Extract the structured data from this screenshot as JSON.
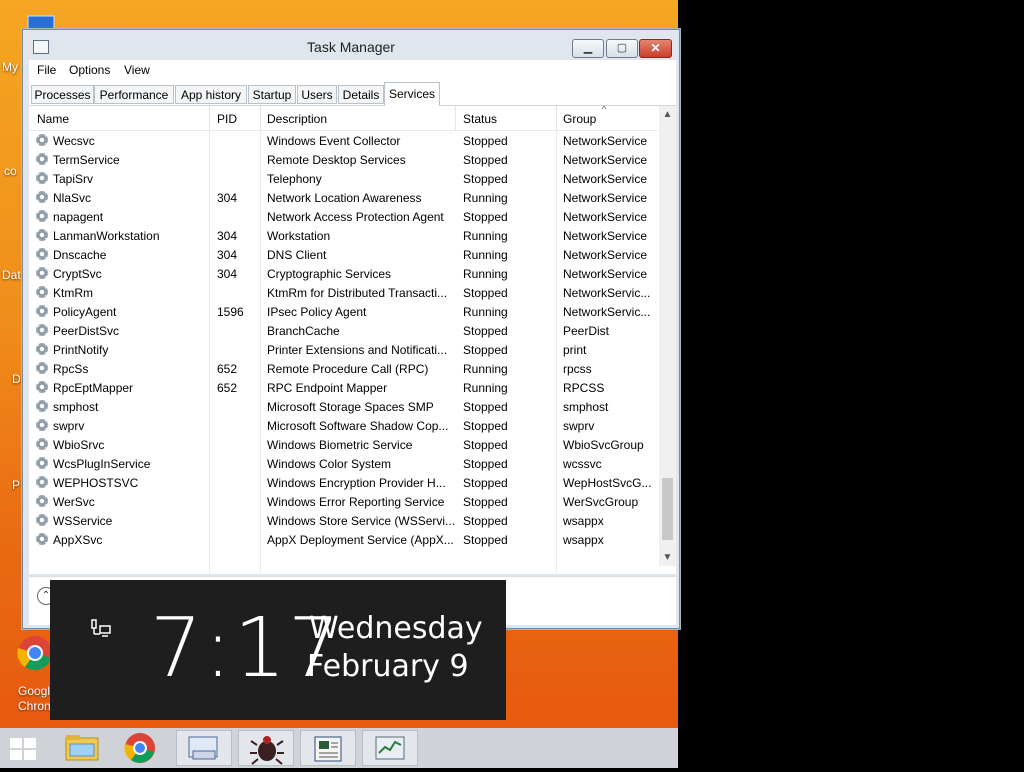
{
  "desktop": {
    "icons": [
      {
        "label": "My"
      },
      {
        "label": "co"
      },
      {
        "label": "Dat"
      },
      {
        "label": "D"
      },
      {
        "label": "P"
      },
      {
        "label": "Googl"
      },
      {
        "label": "Chron"
      }
    ]
  },
  "window": {
    "title": "Task Manager",
    "controls": {
      "minimize": "▁",
      "maximize": "▢",
      "close": "✕"
    }
  },
  "menu": [
    "File",
    "Options",
    "View"
  ],
  "tabs": [
    "Processes",
    "Performance",
    "App history",
    "Startup",
    "Users",
    "Details",
    "Services"
  ],
  "active_tab": "Services",
  "columns": [
    "Name",
    "PID",
    "Description",
    "Status",
    "Group"
  ],
  "sort_indicator": "^",
  "services": [
    {
      "name": "Wecsvc",
      "pid": "",
      "description": "Windows Event Collector",
      "status": "Stopped",
      "group": "NetworkService"
    },
    {
      "name": "TermService",
      "pid": "",
      "description": "Remote Desktop Services",
      "status": "Stopped",
      "group": "NetworkService"
    },
    {
      "name": "TapiSrv",
      "pid": "",
      "description": "Telephony",
      "status": "Stopped",
      "group": "NetworkService"
    },
    {
      "name": "NlaSvc",
      "pid": "304",
      "description": "Network Location Awareness",
      "status": "Running",
      "group": "NetworkService"
    },
    {
      "name": "napagent",
      "pid": "",
      "description": "Network Access Protection Agent",
      "status": "Stopped",
      "group": "NetworkService"
    },
    {
      "name": "LanmanWorkstation",
      "pid": "304",
      "description": "Workstation",
      "status": "Running",
      "group": "NetworkService"
    },
    {
      "name": "Dnscache",
      "pid": "304",
      "description": "DNS Client",
      "status": "Running",
      "group": "NetworkService"
    },
    {
      "name": "CryptSvc",
      "pid": "304",
      "description": "Cryptographic Services",
      "status": "Running",
      "group": "NetworkService"
    },
    {
      "name": "KtmRm",
      "pid": "",
      "description": "KtmRm for Distributed Transacti...",
      "status": "Stopped",
      "group": "NetworkServic..."
    },
    {
      "name": "PolicyAgent",
      "pid": "1596",
      "description": "IPsec Policy Agent",
      "status": "Running",
      "group": "NetworkServic..."
    },
    {
      "name": "PeerDistSvc",
      "pid": "",
      "description": "BranchCache",
      "status": "Stopped",
      "group": "PeerDist"
    },
    {
      "name": "PrintNotify",
      "pid": "",
      "description": "Printer Extensions and Notificati...",
      "status": "Stopped",
      "group": "print"
    },
    {
      "name": "RpcSs",
      "pid": "652",
      "description": "Remote Procedure Call (RPC)",
      "status": "Running",
      "group": "rpcss"
    },
    {
      "name": "RpcEptMapper",
      "pid": "652",
      "description": "RPC Endpoint Mapper",
      "status": "Running",
      "group": "RPCSS"
    },
    {
      "name": "smphost",
      "pid": "",
      "description": "Microsoft Storage Spaces SMP",
      "status": "Stopped",
      "group": "smphost"
    },
    {
      "name": "swprv",
      "pid": "",
      "description": "Microsoft Software Shadow Cop...",
      "status": "Stopped",
      "group": "swprv"
    },
    {
      "name": "WbioSrvc",
      "pid": "",
      "description": "Windows Biometric Service",
      "status": "Stopped",
      "group": "WbioSvcGroup"
    },
    {
      "name": "WcsPlugInService",
      "pid": "",
      "description": "Windows Color System",
      "status": "Stopped",
      "group": "wcssvc"
    },
    {
      "name": "WEPHOSTSVC",
      "pid": "",
      "description": "Windows Encryption Provider H...",
      "status": "Stopped",
      "group": "WepHostSvcG..."
    },
    {
      "name": "WerSvc",
      "pid": "",
      "description": "Windows Error Reporting Service",
      "status": "Stopped",
      "group": "WerSvcGroup"
    },
    {
      "name": "WSService",
      "pid": "",
      "description": "Windows Store Service (WSServi...",
      "status": "Stopped",
      "group": "wsappx"
    },
    {
      "name": "AppXSvc",
      "pid": "",
      "description": "AppX Deployment Service (AppX...",
      "status": "Stopped",
      "group": "wsappx"
    }
  ],
  "clock": {
    "time": "7:17",
    "day": "Wednesday",
    "date": "February 9"
  },
  "taskbar": {
    "items": [
      "start-icon",
      "file-explorer-icon",
      "chrome-icon",
      "keyboard-app-icon",
      "bug-app-icon",
      "reader-app-icon",
      "task-manager-icon"
    ]
  },
  "colors": {
    "desktop_top": "#f5a623",
    "desktop_bottom": "#e85a10",
    "close_button": "#c9402a",
    "taskbar": "#cfd3d8",
    "clock_bg": "#1e1e1e"
  }
}
